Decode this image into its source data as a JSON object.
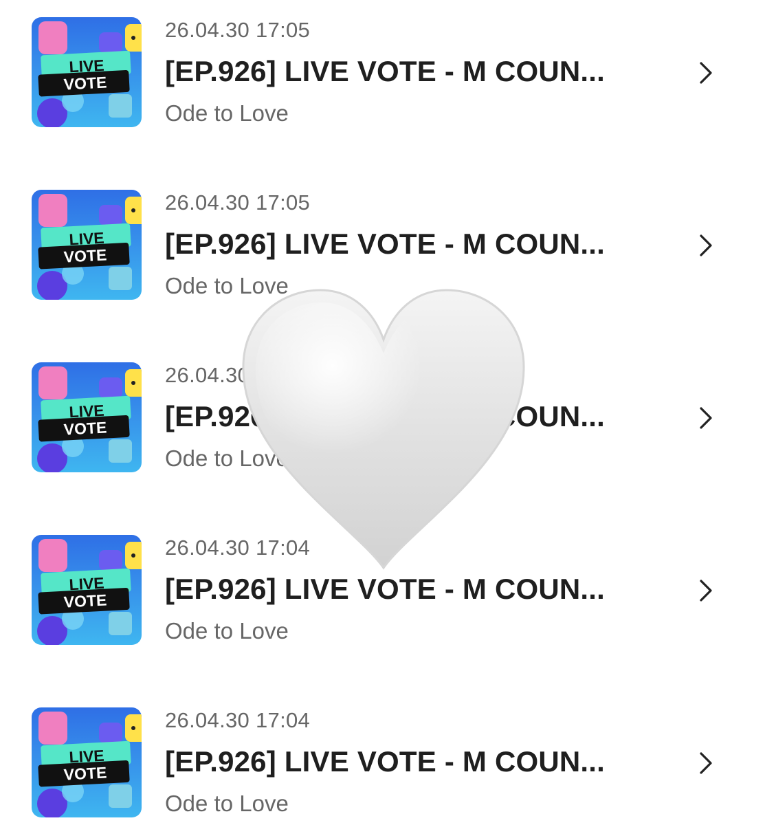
{
  "items": [
    {
      "thumbnail": {
        "line1": "LIVE",
        "line2": "VOTE"
      },
      "timestamp": "26.04.30 17:05",
      "title": "[EP.926] LIVE VOTE - M COUN...",
      "subtitle": "Ode to Love"
    },
    {
      "thumbnail": {
        "line1": "LIVE",
        "line2": "VOTE"
      },
      "timestamp": "26.04.30 17:05",
      "title": "[EP.926] LIVE VOTE - M COUN...",
      "subtitle": "Ode to Love"
    },
    {
      "thumbnail": {
        "line1": "LIVE",
        "line2": "VOTE"
      },
      "timestamp": "26.04.30 17:05",
      "title": "[EP.926] LIVE VOTE - M COUN...",
      "subtitle": "Ode to Love"
    },
    {
      "thumbnail": {
        "line1": "LIVE",
        "line2": "VOTE"
      },
      "timestamp": "26.04.30 17:04",
      "title": "[EP.926] LIVE VOTE - M COUN...",
      "subtitle": "Ode to Love"
    },
    {
      "thumbnail": {
        "line1": "LIVE",
        "line2": "VOTE"
      },
      "timestamp": "26.04.30 17:04",
      "title": "[EP.926] LIVE VOTE - M COUN...",
      "subtitle": "Ode to Love"
    }
  ],
  "overlay": {
    "icon": "white-heart-icon"
  },
  "colors": {
    "title": "#1f1f1f",
    "secondary_text": "#666666",
    "chevron": "#222222",
    "thumb_bg_top": "#2f6fe6",
    "thumb_bg_bottom": "#3fb6f0",
    "thumb_banner": "#55e6c8",
    "heart": "#e4e4e4"
  }
}
